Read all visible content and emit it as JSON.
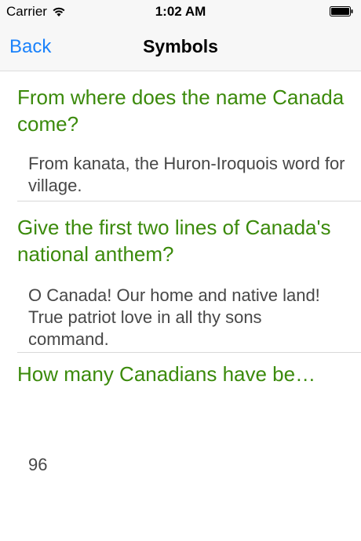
{
  "status_bar": {
    "carrier": "Carrier",
    "time": "1:02 AM"
  },
  "nav": {
    "back_label": "Back",
    "title": "Symbols"
  },
  "items": [
    {
      "question": "From where does the name Canada come?",
      "answer": "From kanata, the Huron-Iroquois word for village."
    },
    {
      "question": "Give the first two lines of Canada's national anthem?",
      "answer": "O Canada! Our home and native land! True patriot love in all thy sons command."
    },
    {
      "question": "How many Canadians have be…",
      "answer": "96"
    }
  ],
  "colors": {
    "question": "#3b8a0b",
    "answer": "#474747",
    "accent": "#1a82fb"
  }
}
